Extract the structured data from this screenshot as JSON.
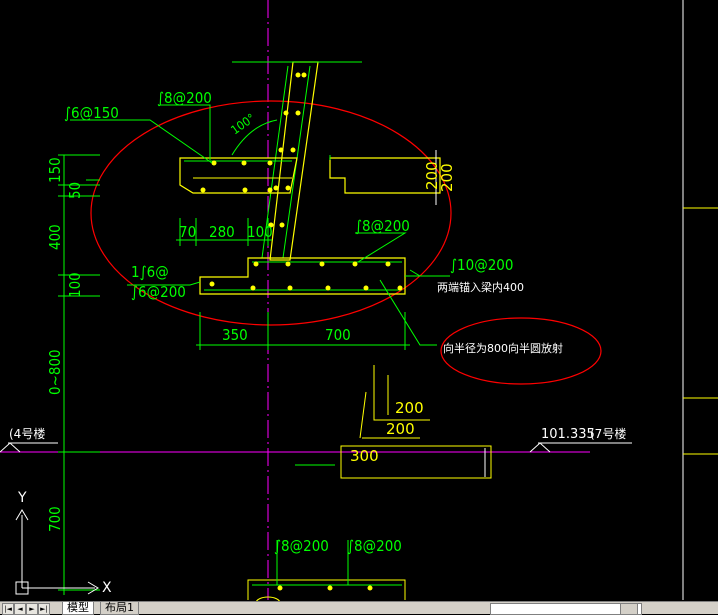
{
  "drawing": {
    "labels": {
      "s6_150": "∫6@150",
      "s8_200_top": "∫8@200",
      "angle": "100°",
      "d150": "150",
      "d50": "50",
      "d400": "400",
      "d100_left": "100",
      "d0_800": "0~800",
      "d700_left": "700",
      "d70": "70",
      "d280": "280",
      "d100_mid": "100",
      "s8_200_mid": "∫8@200",
      "s1_6": "1∫6@",
      "s6_200": "∫6@200",
      "s10_200": "∫10@200",
      "note_400": "两端锚入梁内400",
      "d350": "350",
      "d700": "700",
      "note_800": "向半径为800向半圆放射",
      "d200a": "200",
      "d200b": "200",
      "d200c": "200",
      "d200d": "200",
      "d300": "300",
      "left_ref": "(4号楼",
      "elev": "101.335",
      "right_ref": "(7号楼",
      "bot_s8a": "∫8@200",
      "bot_s8b": "∫8@200"
    },
    "ucs": {
      "y": "Y",
      "x": "X"
    }
  },
  "tabs": [
    {
      "label": "模型"
    },
    {
      "label": "布局1"
    }
  ],
  "colors": {
    "background": "#000000",
    "green": "#00ff00",
    "yellow": "#ffff00",
    "red": "#ff0000",
    "magenta": "#ff00ff",
    "white": "#ffffff"
  }
}
